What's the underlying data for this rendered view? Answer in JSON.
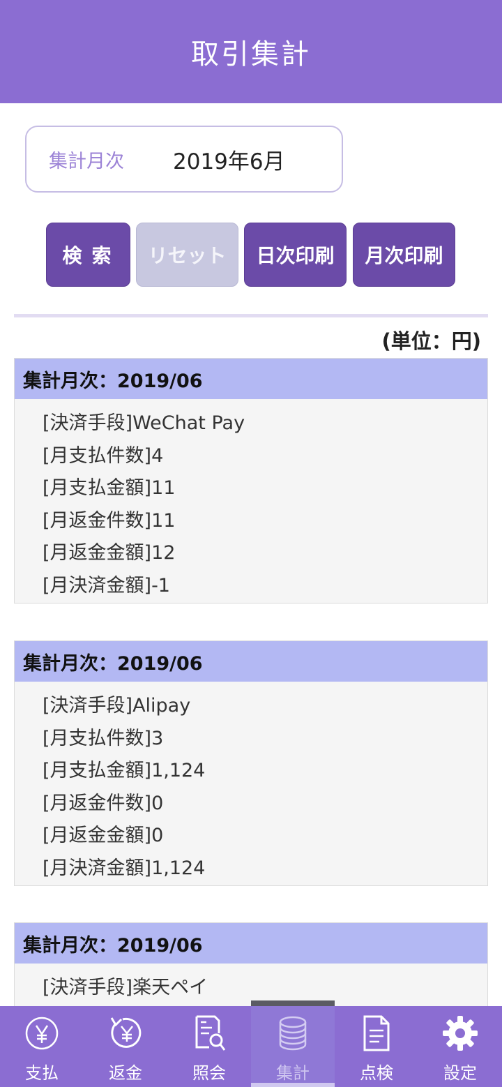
{
  "header": {
    "title": "取引集計"
  },
  "filter": {
    "month_label": "集計月次",
    "month_value": "2019年6月"
  },
  "buttons": {
    "search": "検索",
    "reset": "リセット",
    "daily_print": "日次印刷",
    "monthly_print": "月次印刷"
  },
  "unit_label": "(単位：円)",
  "cards": [
    {
      "title": "集計月次：2019/06",
      "rows": [
        "[決済手段]WeChat Pay",
        "[月支払件数]4",
        "[月支払金額]11",
        "[月返金件数]11",
        "[月返金金額]12",
        "[月決済金額]-1"
      ]
    },
    {
      "title": "集計月次：2019/06",
      "rows": [
        "[決済手段]Alipay",
        "[月支払件数]3",
        "[月支払金額]1,124",
        "[月返金件数]0",
        "[月返金金額]0",
        "[月決済金額]1,124"
      ]
    },
    {
      "title": "集計月次：2019/06",
      "rows": [
        "[決済手段]楽天ペイ"
      ]
    }
  ],
  "tabs": [
    {
      "label": "支払",
      "icon": "yen-circle-icon"
    },
    {
      "label": "返金",
      "icon": "yen-refund-icon"
    },
    {
      "label": "照会",
      "icon": "document-search-icon"
    },
    {
      "label": "集計",
      "icon": "coin-stack-icon",
      "active": true
    },
    {
      "label": "点検",
      "icon": "document-list-icon"
    },
    {
      "label": "設定",
      "icon": "gear-icon"
    }
  ],
  "colors": {
    "primary": "#8b6dd2",
    "button": "#6b4ba8",
    "card_header": "#b3b8f3"
  }
}
